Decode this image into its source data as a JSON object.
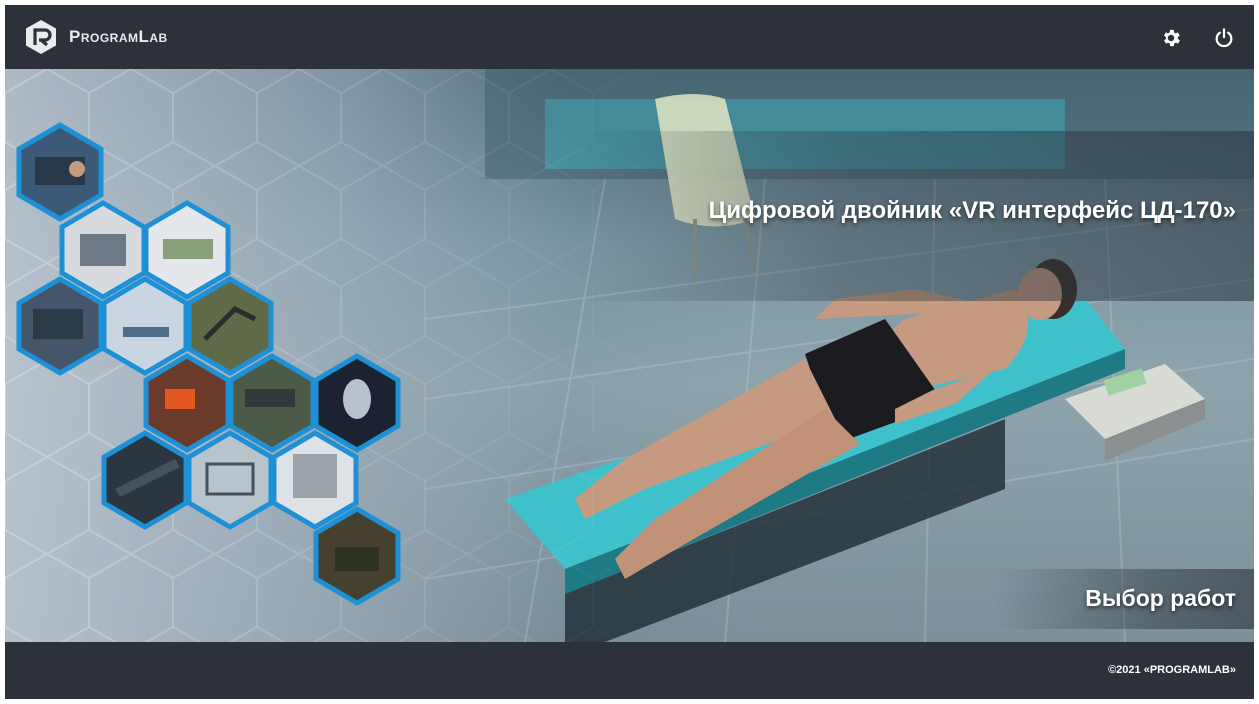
{
  "app": {
    "brand_name": "ProgramLab",
    "accent_color": "#1e90d6"
  },
  "header": {
    "settings_icon": "gear-icon",
    "power_icon": "power-icon"
  },
  "main": {
    "title": "Цифровой двойник «VR интерфейс ЦД-170»",
    "select_works_label": "Выбор работ"
  },
  "footer": {
    "copyright": "©2021 «PROGRAMLAB»"
  }
}
